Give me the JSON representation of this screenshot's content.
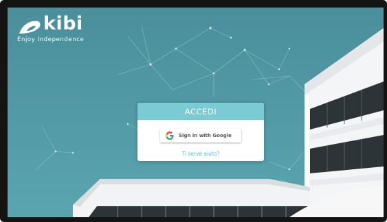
{
  "brand": {
    "name": "kibi",
    "tagline": "Enjoy Independence"
  },
  "login": {
    "title": "ACCEDI",
    "google_button_label": "Sign in with Google",
    "google_icon": "google-g-icon",
    "help_link": "Ti serve aiuto?"
  },
  "colors": {
    "background": "#4b929e",
    "header_accent": "#7acbd4",
    "link": "#5ab8c8"
  }
}
